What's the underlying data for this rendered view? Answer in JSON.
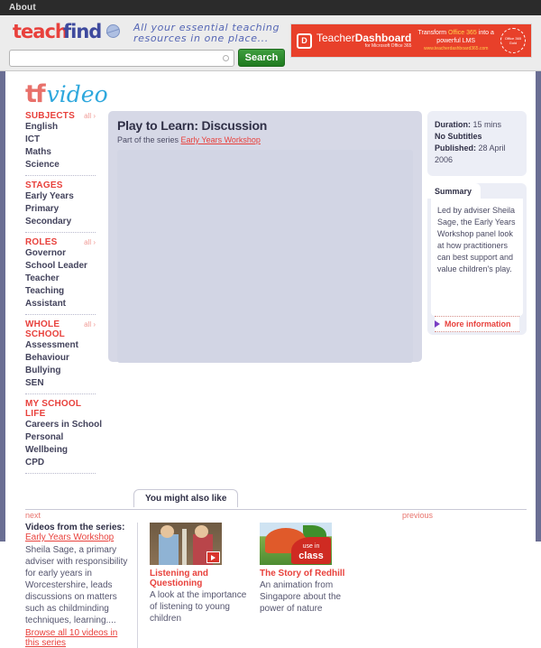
{
  "topbar": {
    "about": "About"
  },
  "brand": {
    "teach": "teach",
    "find": "find",
    "tagline_line1": "All your essential teaching",
    "tagline_line2": "resources in one place..."
  },
  "search": {
    "value": "",
    "placeholder": "",
    "button_label": "Search"
  },
  "ad": {
    "icon_glyph": "D",
    "title_light": "Teacher",
    "title_bold": "Dashboard",
    "subtitle": "for Microsoft Office 365",
    "copy_pre": "Transform ",
    "copy_hl": "Office 365",
    "copy_post": " into a",
    "copy_line2": "powerful LMS",
    "url": "www.teacherdashboard365.com",
    "seal": "Office 365 Gold"
  },
  "video_logo": {
    "tf": "tf",
    "word": "video"
  },
  "sidebar": {
    "groups": [
      {
        "title": "SUBJECTS",
        "all": "all ›",
        "items": [
          "English",
          "ICT",
          "Maths",
          "Science"
        ]
      },
      {
        "title": "STAGES",
        "all": "",
        "items": [
          "Early Years",
          "Primary",
          "Secondary"
        ]
      },
      {
        "title": "ROLES",
        "all": "all ›",
        "items": [
          "Governor",
          "School Leader",
          "Teacher",
          "Teaching Assistant"
        ]
      },
      {
        "title": "WHOLE SCHOOL",
        "all": "all ›",
        "items": [
          "Assessment",
          "Behaviour",
          "Bullying",
          "SEN"
        ]
      },
      {
        "title": "MY SCHOOL LIFE",
        "all": "",
        "items": [
          "Careers in School",
          "Personal Wellbeing",
          "CPD"
        ]
      }
    ]
  },
  "video": {
    "title": "Play to Learn: Discussion",
    "series_prefix": "Part of the series ",
    "series_link": "Early Years Workshop"
  },
  "meta": {
    "duration_label": "Duration:",
    "duration_value": " 15 mins",
    "subtitles": "No Subtitles",
    "published_label": "Published:",
    "published_value": " 28 April 2006"
  },
  "summary": {
    "tab": "Summary",
    "text": "Led by adviser Sheila Sage, the Early Years Workshop panel look at how practitioners can best support and value children's play.",
    "more": "More information"
  },
  "also": {
    "tab": "You might also like",
    "next": "next",
    "previous": "previous",
    "series_heading": "Videos from the series:",
    "series_link": "Early Years Workshop",
    "series_desc": "Sheila Sage, a primary adviser with responsibility for early years in Worcestershire, leads discussions on matters such as childminding techniques, learning....",
    "browse_link": "Browse all 10 videos in this series",
    "cards": [
      {
        "title": "Listening and Questioning",
        "desc": "A look at the importance of listening to young children"
      },
      {
        "title": "The Story of Redhill",
        "desc": "An animation from Singapore about the power of nature",
        "badge_small": "use in",
        "badge_large": "class"
      }
    ]
  },
  "colors": {
    "accent_red": "#e8413c",
    "nav_text": "#43435c",
    "frame": "#6a6e93",
    "panel": "#d6d8e6",
    "search_green": "#1f7a1f"
  }
}
